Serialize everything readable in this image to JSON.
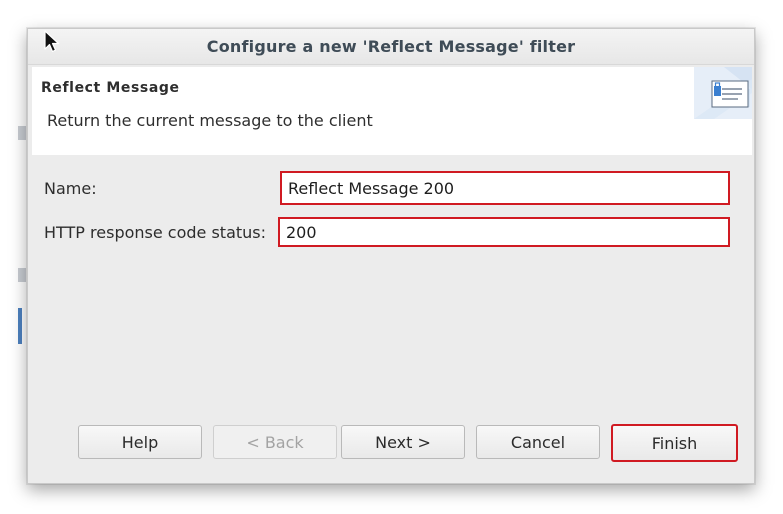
{
  "dialog": {
    "title": "Configure a new 'Reflect Message' filter"
  },
  "header": {
    "title": "Reflect Message",
    "description": "Return the current message to the client",
    "icon": "reflect-message-icon"
  },
  "form": {
    "name_label": "Name:",
    "name_value": "Reflect Message 200",
    "status_label": "HTTP response code status:",
    "status_value": "200"
  },
  "buttons": {
    "help": "Help",
    "back": "< Back",
    "next": "Next >",
    "cancel": "Cancel",
    "finish": "Finish"
  },
  "colors": {
    "highlight": "#d01a22",
    "title_text": "#3f4c57"
  }
}
